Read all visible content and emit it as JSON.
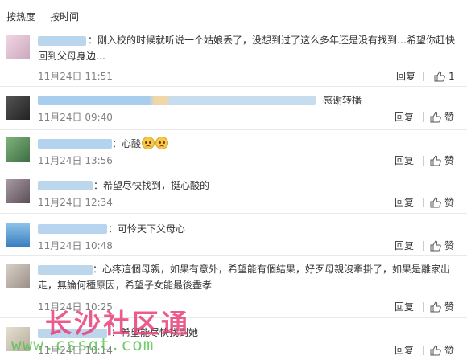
{
  "sort": {
    "hot": "按热度",
    "time": "按时间"
  },
  "colors": {
    "watermark_red": "#e8407a",
    "watermark_green": "#4fc34b",
    "username_blue": "#9ec7ea"
  },
  "comments": [
    {
      "text": "：刚入校的时候就听说一个姑娘丢了，没想到过了这么多年还是没有找到…希望你赶快回到父母身边…",
      "time": "11月24日 11:51",
      "reply": "回复",
      "like": "1"
    },
    {
      "text": "感谢转播",
      "time": "11月24日 09:40",
      "reply": "回复",
      "like": "赞"
    },
    {
      "text": "：心酸",
      "time": "11月24日 13:56",
      "reply": "回复",
      "like": "赞"
    },
    {
      "text": "：希望尽快找到，挺心酸的",
      "time": "11月24日 12:34",
      "reply": "回复",
      "like": "赞"
    },
    {
      "text": "：可怜天下父母心",
      "time": "11月24日 10:48",
      "reply": "回复",
      "like": "赞"
    },
    {
      "text": "：心疼這個母親，如果有意外，希望能有個結果，好歹母親沒牽掛了，如果是離家出走，無論何種原因，希望子女能最後盡孝",
      "time": "11月24日 10:25",
      "reply": "回复",
      "like": "赞"
    },
    {
      "text": "：希望能尽快找到她",
      "time": "11月24日 10:14",
      "reply": "回复",
      "like": "赞"
    }
  ],
  "watermark": {
    "title": "长沙社区通",
    "url": "www.cssqt.com"
  }
}
